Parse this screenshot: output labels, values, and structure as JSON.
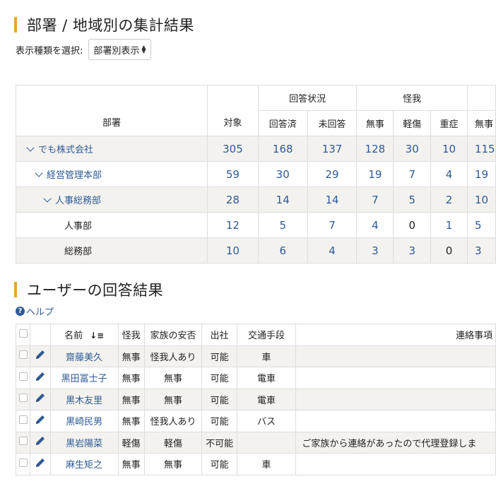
{
  "summary_section": {
    "title": "部署 / 地域別の集計結果"
  },
  "selector": {
    "label": "表示種類を選択:",
    "value": "部署別表示"
  },
  "summary_table": {
    "headers": {
      "dept": "部署",
      "target": "対象",
      "group_answer": "回答状況",
      "answered": "回答済",
      "unanswered": "未回答",
      "group_injury": "怪我",
      "none": "無事",
      "minor": "軽傷",
      "severe": "重症",
      "extra": "無事"
    },
    "rows": [
      {
        "name": "でも株式会社",
        "target": "305",
        "answered": "168",
        "unanswered": "137",
        "none": "128",
        "minor": "30",
        "severe": "10",
        "extra": "115"
      },
      {
        "name": "経営管理本部",
        "target": "59",
        "answered": "30",
        "unanswered": "29",
        "none": "19",
        "minor": "7",
        "severe": "4",
        "extra": "19"
      },
      {
        "name": "人事総務部",
        "target": "28",
        "answered": "14",
        "unanswered": "14",
        "none": "7",
        "minor": "5",
        "severe": "2",
        "extra": "10"
      },
      {
        "name": "人事部",
        "target": "12",
        "answered": "5",
        "unanswered": "7",
        "none": "4",
        "minor": "0",
        "severe": "1",
        "extra": "5"
      },
      {
        "name": "総務部",
        "target": "10",
        "answered": "6",
        "unanswered": "4",
        "none": "3",
        "minor": "3",
        "severe": "0",
        "extra": "3"
      }
    ]
  },
  "user_section": {
    "title": "ユーザーの回答結果",
    "help": "ヘルプ"
  },
  "user_table": {
    "headers": {
      "name": "名前",
      "injury": "怪我",
      "family": "家族の安否",
      "attend": "出社",
      "transport": "交通手段",
      "note": "連絡事項"
    },
    "rows": [
      {
        "name": "齋藤美久",
        "injury": "無事",
        "family": "怪我人あり",
        "attend": "可能",
        "transport": "車",
        "note": ""
      },
      {
        "name": "黒田冨士子",
        "injury": "無事",
        "family": "無事",
        "attend": "可能",
        "transport": "電車",
        "note": ""
      },
      {
        "name": "黒木友里",
        "injury": "無事",
        "family": "無事",
        "attend": "可能",
        "transport": "電車",
        "note": ""
      },
      {
        "name": "黒崎民男",
        "injury": "無事",
        "family": "怪我人あり",
        "attend": "可能",
        "transport": "バス",
        "note": ""
      },
      {
        "name": "黒岩陽菜",
        "injury": "軽傷",
        "family": "軽傷",
        "attend": "不可能",
        "transport": "",
        "note": "ご家族から連絡があったので代理登録しま"
      },
      {
        "name": "麻生矩之",
        "injury": "無事",
        "family": "無事",
        "attend": "可能",
        "transport": "車",
        "note": ""
      }
    ]
  },
  "colors": {
    "accent": "#e8a33c",
    "link": "#2d5b96",
    "row_alt": "#f4f2ef",
    "border": "#dddddd"
  },
  "icons": {
    "edit": "pencil-icon",
    "sort": "sort-desc-icon",
    "help": "help-circle-icon"
  }
}
